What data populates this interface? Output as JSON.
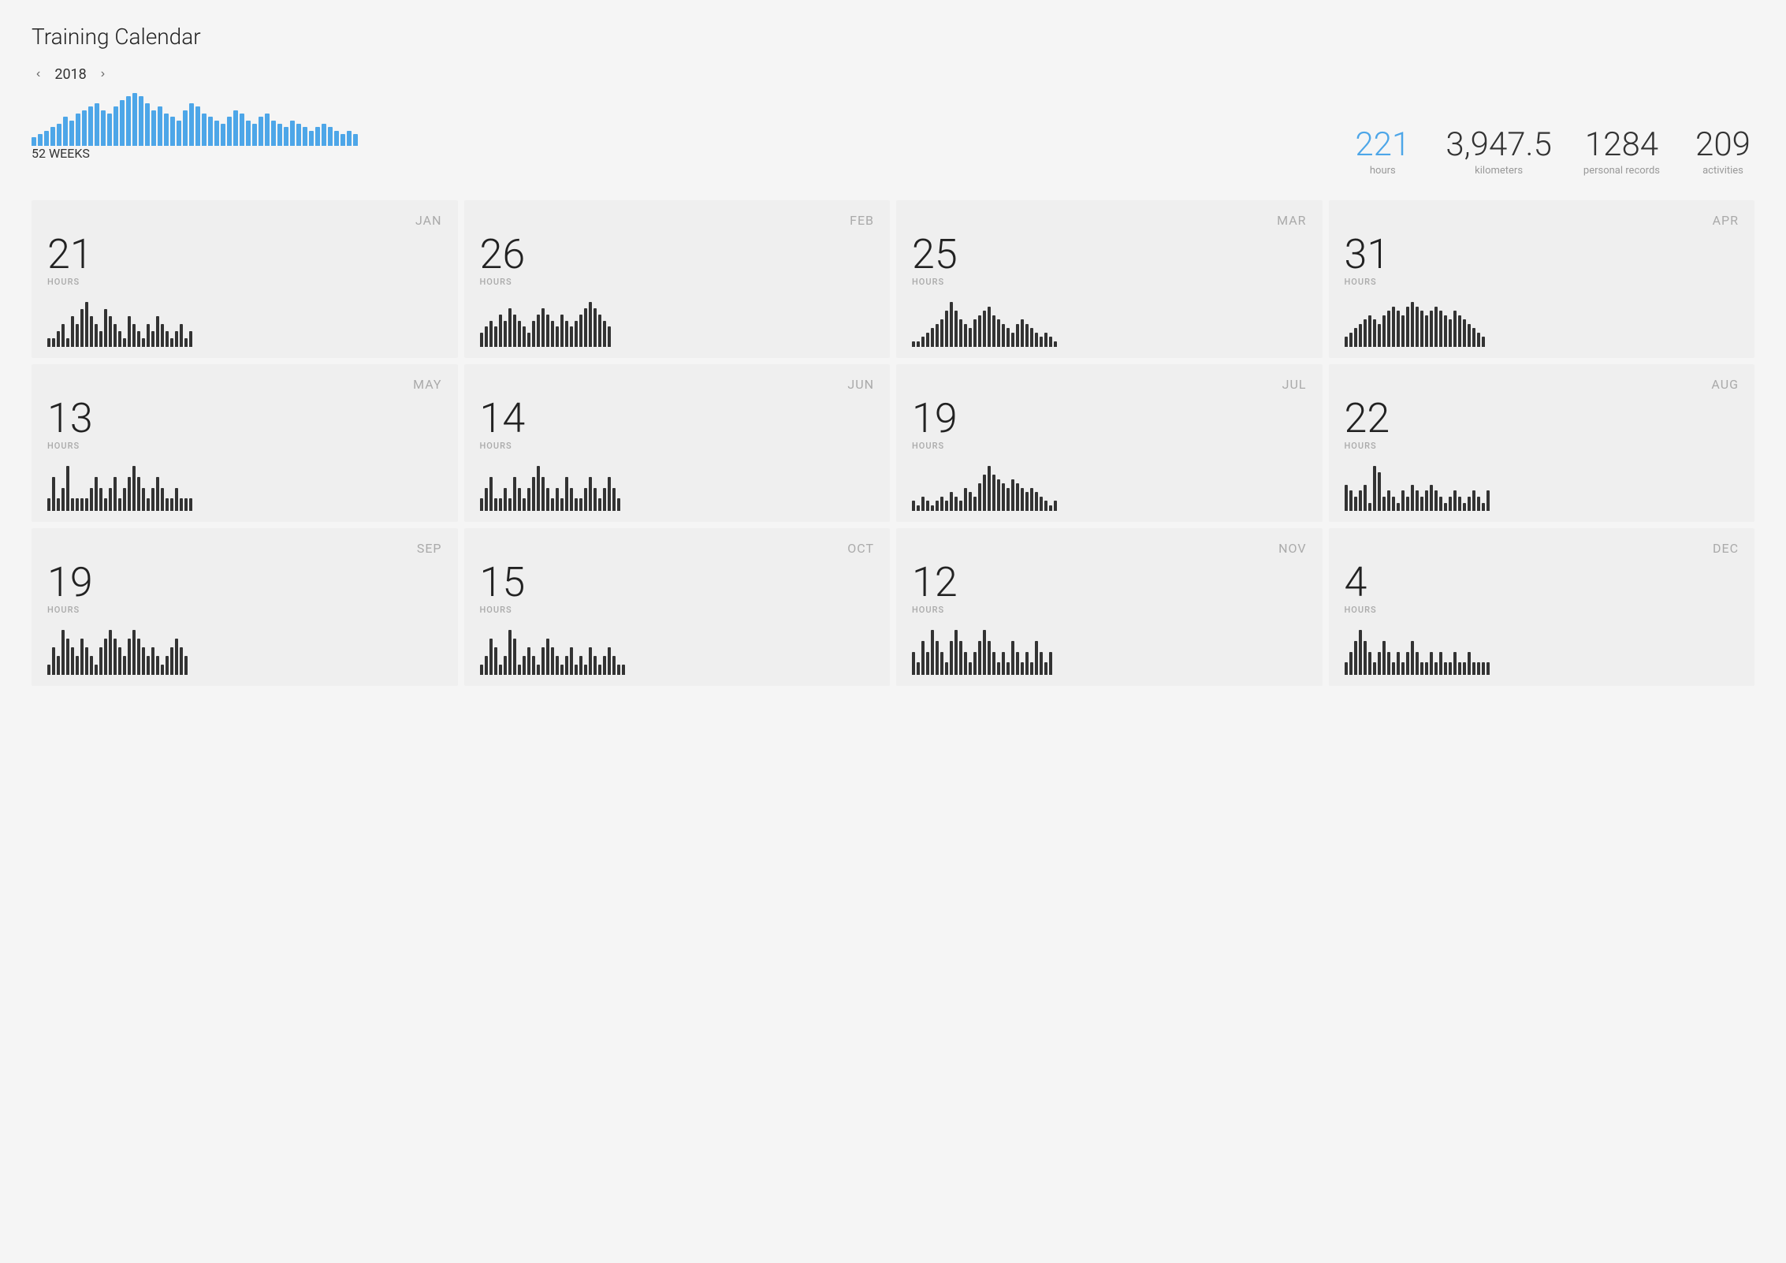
{
  "page": {
    "title": "Training Calendar"
  },
  "year_nav": {
    "prev_label": "‹",
    "next_label": "›",
    "year": "2018",
    "weeks_label": "52 WEEKS"
  },
  "stats": [
    {
      "value": "221",
      "label": "Hours",
      "highlight": true
    },
    {
      "value": "3,947.5",
      "label": "kilometers",
      "highlight": false
    },
    {
      "value": "1284",
      "label": "Personal Records",
      "highlight": false
    },
    {
      "value": "209",
      "label": "Activities",
      "highlight": false
    }
  ],
  "header_bars": [
    2,
    3,
    4,
    5,
    6,
    8,
    7,
    9,
    10,
    11,
    12,
    10,
    9,
    11,
    13,
    14,
    15,
    14,
    12,
    10,
    11,
    9,
    8,
    7,
    10,
    12,
    11,
    9,
    8,
    7,
    6,
    8,
    10,
    9,
    7,
    6,
    8,
    9,
    7,
    6,
    5,
    7,
    6,
    5,
    4,
    5,
    6,
    5,
    4,
    3,
    4,
    3
  ],
  "months": [
    {
      "name": "JAN",
      "hours": "21",
      "bars": [
        1,
        1,
        2,
        3,
        1,
        4,
        3,
        5,
        6,
        4,
        3,
        2,
        5,
        4,
        3,
        2,
        1,
        4,
        3,
        2,
        1,
        3,
        2,
        4,
        3,
        2,
        1,
        2,
        3,
        1,
        2
      ]
    },
    {
      "name": "FEB",
      "hours": "26",
      "bars": [
        2,
        3,
        4,
        3,
        5,
        4,
        6,
        5,
        4,
        3,
        2,
        4,
        5,
        6,
        5,
        4,
        3,
        5,
        4,
        3,
        4,
        5,
        6,
        7,
        6,
        5,
        4,
        3
      ]
    },
    {
      "name": "MAR",
      "hours": "25",
      "bars": [
        1,
        1,
        2,
        3,
        4,
        5,
        6,
        8,
        10,
        8,
        6,
        5,
        4,
        6,
        7,
        8,
        9,
        7,
        6,
        5,
        4,
        3,
        5,
        6,
        5,
        4,
        3,
        2,
        3,
        2,
        1
      ]
    },
    {
      "name": "APR",
      "hours": "31",
      "bars": [
        2,
        3,
        4,
        5,
        6,
        7,
        6,
        5,
        7,
        8,
        9,
        8,
        7,
        9,
        10,
        9,
        8,
        7,
        8,
        9,
        8,
        7,
        6,
        8,
        7,
        6,
        5,
        4,
        3,
        2
      ]
    },
    {
      "name": "MAY",
      "hours": "13",
      "bars": [
        1,
        3,
        1,
        2,
        4,
        1,
        1,
        1,
        1,
        2,
        3,
        2,
        1,
        2,
        3,
        1,
        2,
        3,
        4,
        3,
        2,
        1,
        2,
        3,
        2,
        1,
        1,
        2,
        1,
        1,
        1
      ]
    },
    {
      "name": "JUN",
      "hours": "14",
      "bars": [
        1,
        2,
        3,
        1,
        1,
        2,
        1,
        3,
        2,
        1,
        2,
        3,
        4,
        3,
        2,
        1,
        2,
        1,
        3,
        2,
        1,
        1,
        2,
        3,
        2,
        1,
        2,
        3,
        2,
        1
      ]
    },
    {
      "name": "JUL",
      "hours": "19",
      "bars": [
        2,
        1,
        3,
        2,
        1,
        2,
        3,
        2,
        4,
        3,
        2,
        5,
        4,
        3,
        6,
        8,
        10,
        8,
        7,
        6,
        5,
        7,
        6,
        5,
        4,
        5,
        4,
        3,
        2,
        1,
        2
      ]
    },
    {
      "name": "AUG",
      "hours": "22",
      "bars": [
        4,
        3,
        2,
        3,
        4,
        1,
        7,
        6,
        2,
        3,
        2,
        1,
        3,
        2,
        4,
        3,
        2,
        3,
        4,
        3,
        2,
        1,
        2,
        3,
        2,
        1,
        2,
        3,
        2,
        1,
        3
      ]
    },
    {
      "name": "SEP",
      "hours": "19",
      "bars": [
        1,
        3,
        2,
        5,
        4,
        3,
        2,
        4,
        3,
        2,
        1,
        3,
        4,
        5,
        4,
        3,
        2,
        4,
        5,
        4,
        3,
        2,
        3,
        2,
        1,
        2,
        3,
        4,
        3,
        2
      ]
    },
    {
      "name": "OCT",
      "hours": "15",
      "bars": [
        1,
        2,
        4,
        3,
        1,
        2,
        5,
        4,
        1,
        2,
        3,
        2,
        1,
        3,
        4,
        3,
        2,
        1,
        2,
        3,
        1,
        2,
        1,
        3,
        2,
        1,
        2,
        3,
        2,
        1,
        1
      ]
    },
    {
      "name": "NOV",
      "hours": "12",
      "bars": [
        2,
        1,
        3,
        2,
        4,
        3,
        2,
        1,
        3,
        4,
        3,
        2,
        1,
        2,
        3,
        4,
        3,
        2,
        1,
        2,
        1,
        3,
        2,
        1,
        2,
        1,
        3,
        2,
        1,
        2
      ]
    },
    {
      "name": "DEC",
      "hours": "4",
      "bars": [
        1,
        2,
        3,
        4,
        3,
        2,
        1,
        2,
        3,
        2,
        1,
        2,
        1,
        2,
        3,
        2,
        1,
        1,
        2,
        1,
        2,
        1,
        1,
        2,
        1,
        1,
        2,
        1,
        1,
        1,
        1
      ]
    }
  ]
}
